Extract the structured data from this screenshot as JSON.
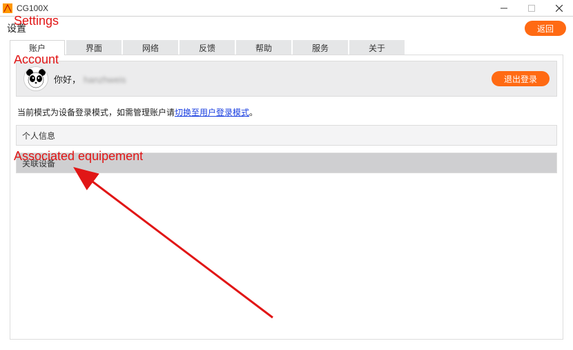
{
  "window": {
    "title": "CG100X"
  },
  "header": {
    "page_title": "设置",
    "back_label": "返回"
  },
  "tabs": [
    {
      "label": "账户"
    },
    {
      "label": "界面"
    },
    {
      "label": "网络"
    },
    {
      "label": "反馈"
    },
    {
      "label": "帮助"
    },
    {
      "label": "服务"
    },
    {
      "label": "关于"
    }
  ],
  "account": {
    "greeting": "你好，",
    "username": "hanzhweis",
    "logout_label": "退出登录",
    "mode_prefix": "当前模式为设备登录模式，如需管理账户请",
    "mode_link": "切换至用户登录模式",
    "mode_suffix": "。",
    "section_personal": "个人信息",
    "section_devices": "关联设备"
  },
  "annotations": {
    "a1": "Settings",
    "a2": "Account",
    "a3": "Associated equipement"
  }
}
